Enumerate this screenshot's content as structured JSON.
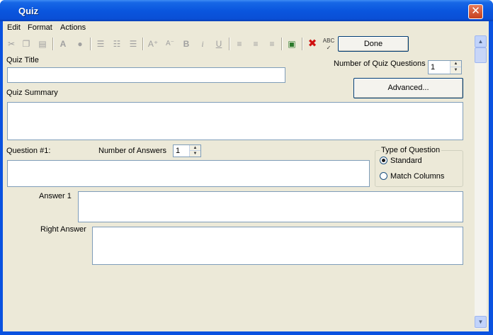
{
  "window": {
    "title": "Quiz",
    "close_glyph": "✕"
  },
  "menu": {
    "items": [
      "Edit",
      "Format",
      "Actions"
    ]
  },
  "toolbar": {
    "icons": [
      "cut-icon",
      "copy-icon",
      "paste-icon",
      "font-icon",
      "color-icon",
      "bullet-list-icon",
      "numbered-list-icon",
      "outline-list-icon",
      "increase-font-icon",
      "decrease-font-icon",
      "bold-icon",
      "italic-icon",
      "underline-icon",
      "align-left-icon",
      "align-center-icon",
      "align-right-icon",
      "insert-icon",
      "delete-icon",
      "spellcheck-icon"
    ],
    "done_label": "Done"
  },
  "quiz": {
    "title_label": "Quiz Title",
    "title_value": "",
    "num_questions_label": "Number of Quiz Questions",
    "num_questions_value": "1",
    "advanced_label": "Advanced...",
    "summary_label": "Quiz Summary",
    "summary_value": ""
  },
  "question": {
    "label": "Question #1:",
    "num_answers_label": "Number of Answers",
    "num_answers_value": "1",
    "type_group_label": "Type of Question",
    "type_options": [
      "Standard",
      "Match Columns"
    ],
    "type_selected": "Standard"
  },
  "answers": {
    "answer1_label": "Answer 1",
    "right_answer_label": "Right Answer"
  }
}
